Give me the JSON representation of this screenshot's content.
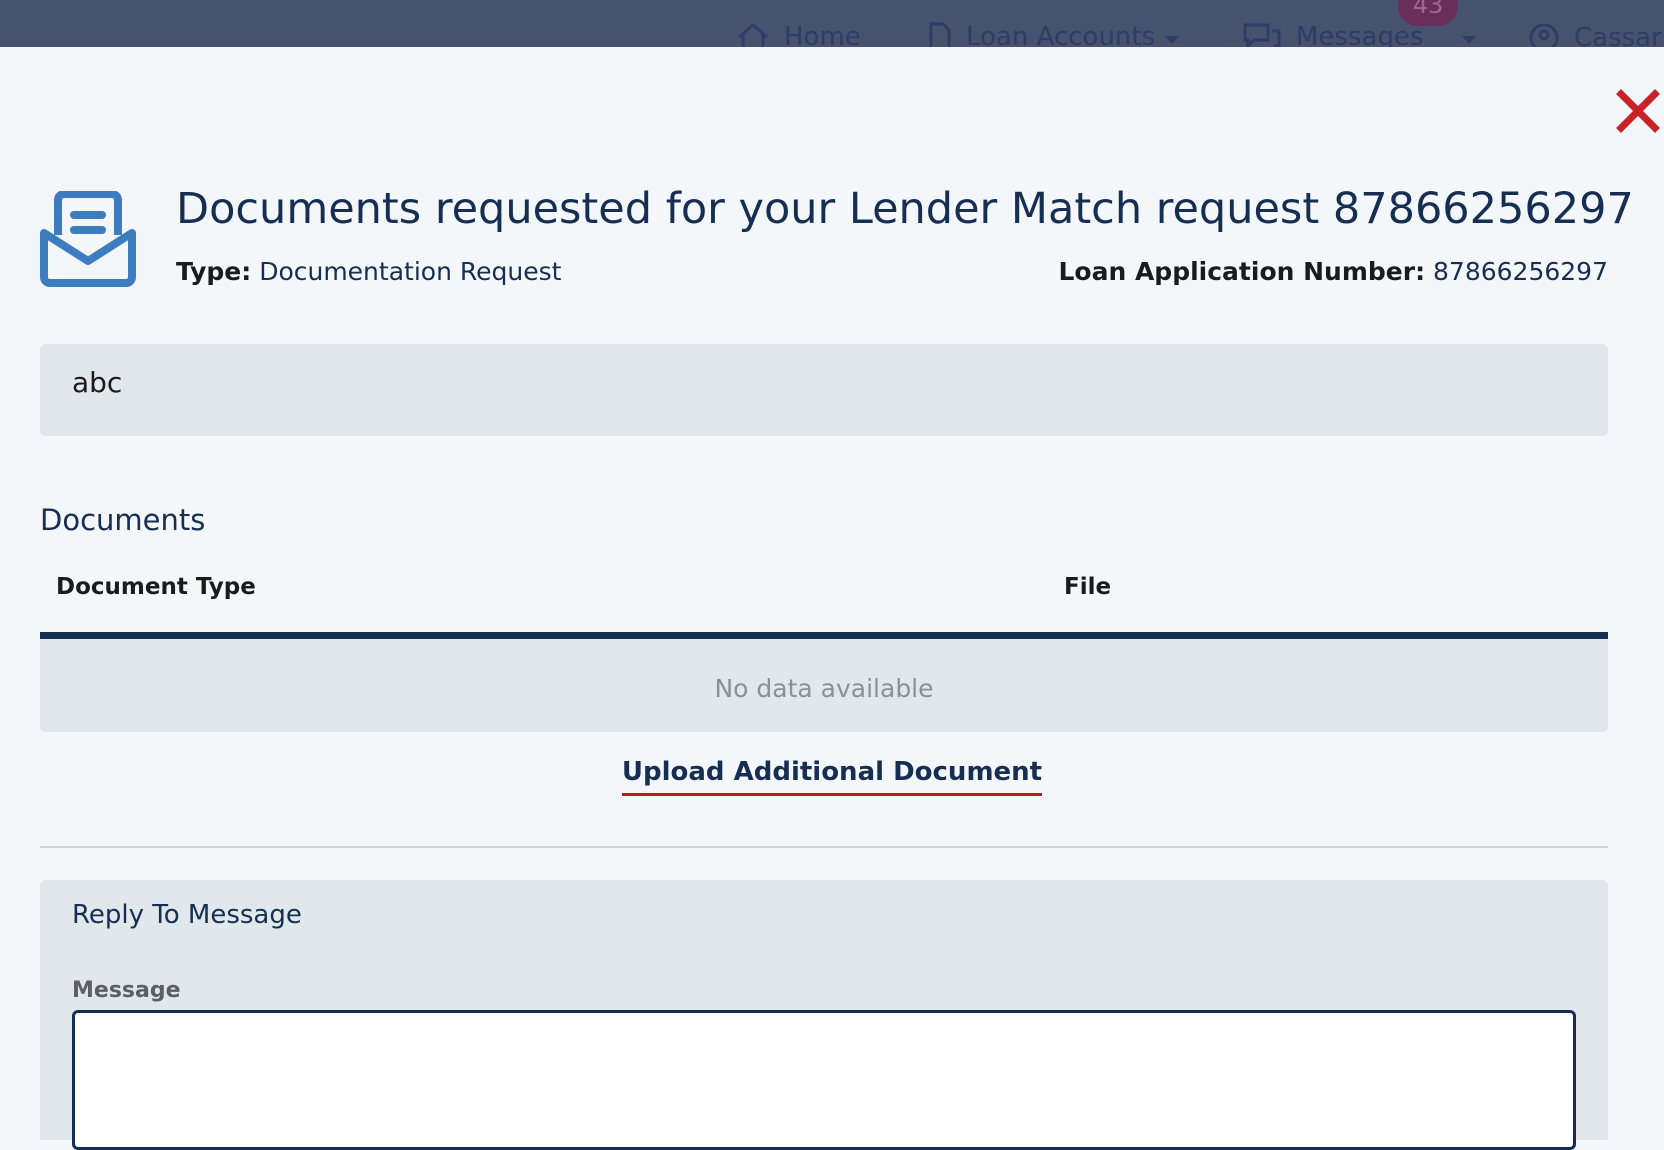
{
  "nav": {
    "home": "Home",
    "loan_accounts": "Loan Accounts",
    "messages": "Messages",
    "messages_badge": "43",
    "user": "Cassar"
  },
  "modal": {
    "title": "Documents requested for your Lender Match request 87866256297",
    "type_label": "Type:",
    "type_value": "Documentation Request",
    "loan_label": "Loan Application Number:",
    "loan_value": "87866256297",
    "message_body": "abc"
  },
  "documents": {
    "heading": "Documents",
    "columns": [
      "Document Type",
      "File"
    ],
    "empty_text": "No data available",
    "upload_link": "Upload Additional Document"
  },
  "reply": {
    "title": "Reply To Message",
    "message_label": "Message",
    "message_value": ""
  },
  "colors": {
    "primary_navy": "#162e51",
    "accent_red": "#b51d1f",
    "panel_gray": "#e1e8ec",
    "nav_bg": "#47526e"
  }
}
